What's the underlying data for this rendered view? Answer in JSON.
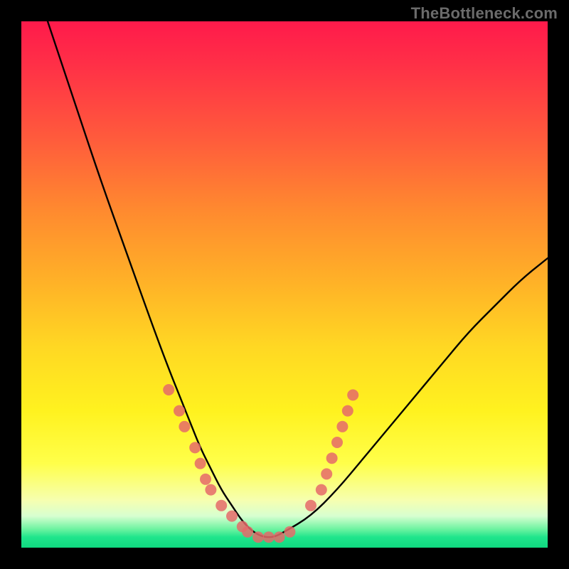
{
  "attribution": "TheBottleneck.com",
  "chart_data": {
    "type": "line",
    "title": "",
    "xlabel": "",
    "ylabel": "",
    "xlim": [
      0,
      100
    ],
    "ylim": [
      0,
      100
    ],
    "grid": false,
    "legend": false,
    "series": [
      {
        "name": "bottleneck-curve",
        "x": [
          5,
          10,
          15,
          20,
          25,
          28,
          30,
          32,
          34,
          36,
          38,
          40,
          42,
          44,
          46,
          48,
          50,
          55,
          60,
          65,
          70,
          75,
          80,
          85,
          90,
          95,
          100
        ],
        "y": [
          100,
          85,
          70,
          56,
          42,
          34,
          29,
          24,
          19,
          15,
          11,
          8,
          5,
          3,
          2,
          2,
          3,
          6,
          11,
          17,
          23,
          29,
          35,
          41,
          46,
          51,
          55
        ]
      }
    ],
    "annotations": {
      "marker_clusters": [
        {
          "name": "left-descent-dots",
          "side": "left",
          "points": [
            {
              "x": 28,
              "y": 30
            },
            {
              "x": 30,
              "y": 26
            },
            {
              "x": 31,
              "y": 23
            },
            {
              "x": 33,
              "y": 19
            },
            {
              "x": 34,
              "y": 16
            },
            {
              "x": 35,
              "y": 13
            },
            {
              "x": 36,
              "y": 11
            },
            {
              "x": 38,
              "y": 8
            },
            {
              "x": 40,
              "y": 6
            },
            {
              "x": 42,
              "y": 4
            }
          ]
        },
        {
          "name": "valley-dots",
          "side": "bottom",
          "points": [
            {
              "x": 43,
              "y": 3
            },
            {
              "x": 45,
              "y": 2
            },
            {
              "x": 47,
              "y": 2
            },
            {
              "x": 49,
              "y": 2
            },
            {
              "x": 51,
              "y": 3
            }
          ]
        },
        {
          "name": "right-ascent-dots",
          "side": "right",
          "points": [
            {
              "x": 55,
              "y": 8
            },
            {
              "x": 57,
              "y": 11
            },
            {
              "x": 58,
              "y": 14
            },
            {
              "x": 59,
              "y": 17
            },
            {
              "x": 60,
              "y": 20
            },
            {
              "x": 61,
              "y": 23
            },
            {
              "x": 62,
              "y": 26
            },
            {
              "x": 63,
              "y": 29
            }
          ]
        }
      ],
      "marker_color": "#e56a6a",
      "marker_radius_px": 8
    }
  }
}
